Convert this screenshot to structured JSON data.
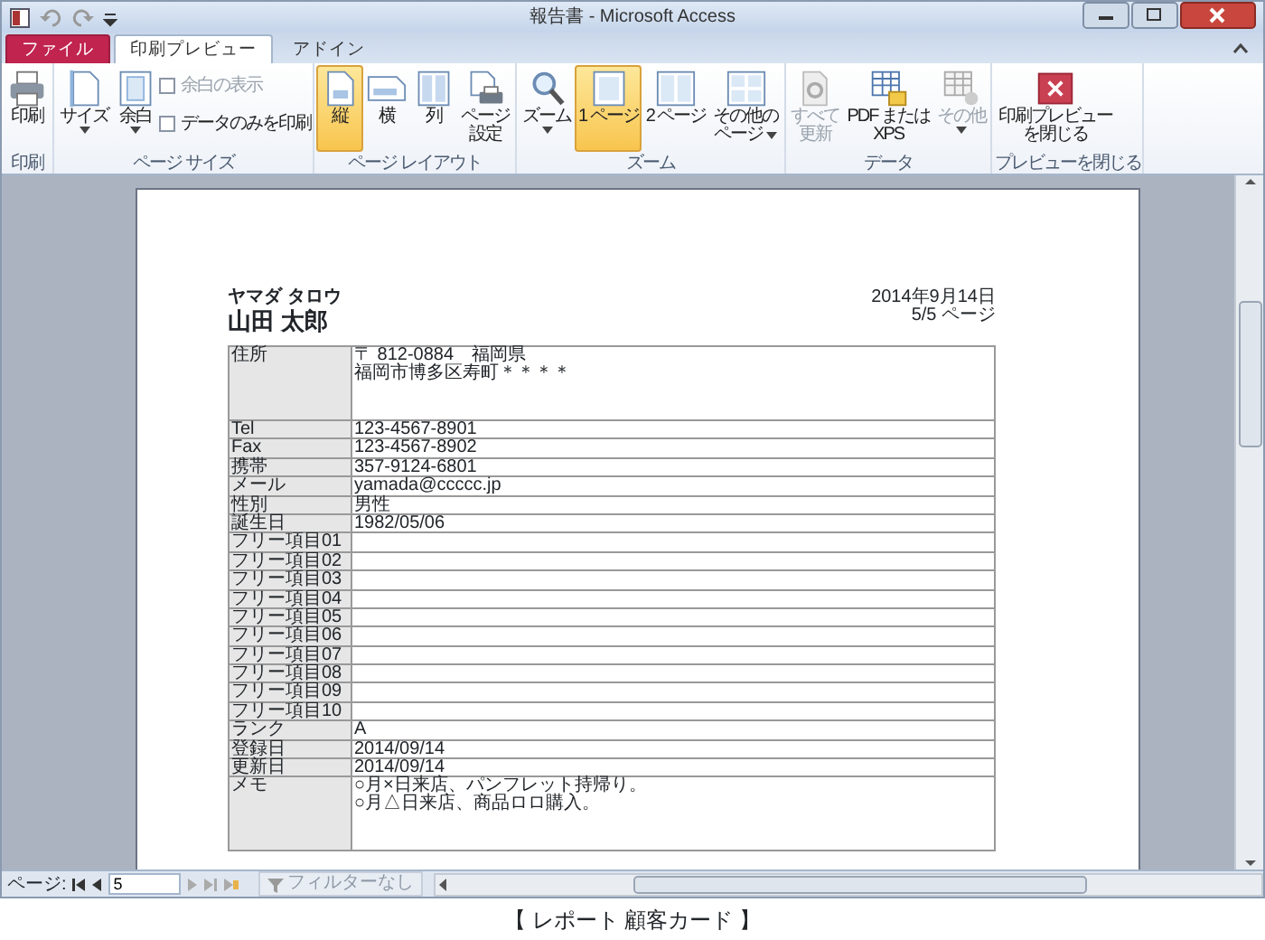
{
  "window": {
    "title": "報告書 - Microsoft Access"
  },
  "ribbon_tabs": [
    {
      "label": "ファイル",
      "kind": "file",
      "selected": false
    },
    {
      "label": "印刷プレビュー",
      "kind": "tab",
      "selected": true
    },
    {
      "label": "アドイン",
      "kind": "tab",
      "selected": false
    }
  ],
  "ribbon_groups": [
    {
      "label": "印刷",
      "controls": [
        {
          "kind": "large",
          "label": "印刷",
          "caret": false,
          "selected": false,
          "disabled": false
        }
      ]
    },
    {
      "label": "ページ サイズ",
      "controls": [
        {
          "kind": "large",
          "label": "サイズ",
          "caret": true,
          "selected": false,
          "disabled": false
        },
        {
          "kind": "large",
          "label": "余白",
          "caret": true,
          "selected": false,
          "disabled": false
        },
        {
          "kind": "check",
          "label": "余白の表示",
          "checked": false,
          "disabled": true
        },
        {
          "kind": "check",
          "label": "データのみを印刷",
          "checked": false,
          "disabled": false
        }
      ]
    },
    {
      "label": "ページ レイアウト",
      "controls": [
        {
          "kind": "large",
          "label": "縦",
          "caret": false,
          "selected": true,
          "disabled": false
        },
        {
          "kind": "large",
          "label": "横",
          "caret": false,
          "selected": false,
          "disabled": false
        },
        {
          "kind": "large",
          "label": "列",
          "caret": false,
          "selected": false,
          "disabled": false
        },
        {
          "kind": "large",
          "label": [
            "ページ",
            "設定"
          ],
          "caret": false,
          "selected": false,
          "disabled": false
        }
      ]
    },
    {
      "label": "ズーム",
      "controls": [
        {
          "kind": "large",
          "label": "ズーム",
          "caret": true,
          "selected": false,
          "disabled": false
        },
        {
          "kind": "large",
          "label": "1 ページ",
          "caret": false,
          "selected": true,
          "disabled": false
        },
        {
          "kind": "large",
          "label": "2 ページ",
          "caret": false,
          "selected": false,
          "disabled": false
        },
        {
          "kind": "large",
          "label": [
            "その他の",
            "ページ"
          ],
          "caret": true,
          "selected": false,
          "disabled": false
        }
      ]
    },
    {
      "label": "データ",
      "controls": [
        {
          "kind": "large",
          "label": [
            "すべて",
            "更新"
          ],
          "caret": false,
          "selected": false,
          "disabled": true
        },
        {
          "kind": "large",
          "label": [
            "PDF または",
            "XPS"
          ],
          "caret": false,
          "selected": false,
          "disabled": false
        },
        {
          "kind": "large",
          "label": "その他",
          "caret": true,
          "selected": false,
          "disabled": true
        }
      ]
    },
    {
      "label": "プレビューを閉じる",
      "controls": [
        {
          "kind": "large",
          "label": [
            "印刷プレビュー",
            "を閉じる"
          ],
          "caret": false,
          "selected": false,
          "disabled": false
        }
      ]
    }
  ],
  "report": {
    "kana": "ヤマダ タロウ",
    "name": "山田 太郎",
    "date": "2014年9月14日",
    "page": "5/5 ページ",
    "rows": [
      {
        "label": "住所",
        "kind": "tall",
        "value": [
          "〒 812-0884　福岡県",
          "福岡市博多区寿町＊＊＊＊"
        ]
      },
      {
        "label": "Tel",
        "kind": "line",
        "value": "123-4567-8901"
      },
      {
        "label": "Fax",
        "kind": "line",
        "value": "123-4567-8902"
      },
      {
        "label": "携帯",
        "kind": "line",
        "value": "357-9124-6801"
      },
      {
        "label": "メール",
        "kind": "line",
        "value": "yamada@ccccc.jp"
      },
      {
        "label": "性別",
        "kind": "line",
        "value": "男性"
      },
      {
        "label": "誕生日",
        "kind": "line",
        "value": "1982/05/06"
      },
      {
        "label": "フリー項目01",
        "kind": "line"
      },
      {
        "label": "フリー項目02",
        "kind": "line"
      },
      {
        "label": "フリー項目03",
        "kind": "line"
      },
      {
        "label": "フリー項目04",
        "kind": "line"
      },
      {
        "label": "フリー項目05",
        "kind": "line"
      },
      {
        "label": "フリー項目06",
        "kind": "line"
      },
      {
        "label": "フリー項目07",
        "kind": "line"
      },
      {
        "label": "フリー項目08",
        "kind": "line"
      },
      {
        "label": "フリー項目09",
        "kind": "line"
      },
      {
        "label": "フリー項目10",
        "kind": "line"
      },
      {
        "label": "ランク",
        "kind": "line",
        "value": "A"
      },
      {
        "label": "登録日",
        "kind": "line",
        "value": "2014/09/14"
      },
      {
        "label": "更新日",
        "kind": "line",
        "value": "2014/09/14"
      },
      {
        "label": "メモ",
        "kind": "tall",
        "value": [
          "○月×日来店、パンフレット持帰り。",
          "○月△日来店、商品ロロ購入。"
        ]
      }
    ]
  },
  "status_bar": {
    "page_label": "ページ:",
    "page_value": "5",
    "filter": {
      "label": "フィルターなし",
      "disabled": true
    }
  },
  "caption": "【 レポート 顧客カード 】"
}
